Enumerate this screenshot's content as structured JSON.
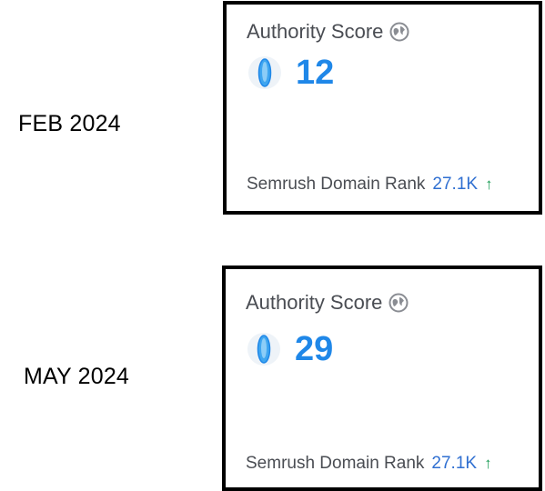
{
  "snapshots": [
    {
      "period": "FEB 2024",
      "title": "Authority Score",
      "score": "12",
      "rank_label": "Semrush Domain Rank",
      "rank_value": "27.1K",
      "rank_trend": "up"
    },
    {
      "period": "MAY 2024",
      "title": "Authority Score",
      "score": "29",
      "rank_label": "Semrush Domain Rank",
      "rank_value": "27.1K",
      "rank_trend": "up"
    }
  ],
  "icons": {
    "info": "globe-icon",
    "gauge": "gauge-icon",
    "trend": "arrow-up-icon"
  },
  "colors": {
    "score": "#1f87e8",
    "rank_value": "#2f6fd1",
    "trend_up": "#1a9c55",
    "text_secondary": "#4a4d53"
  }
}
